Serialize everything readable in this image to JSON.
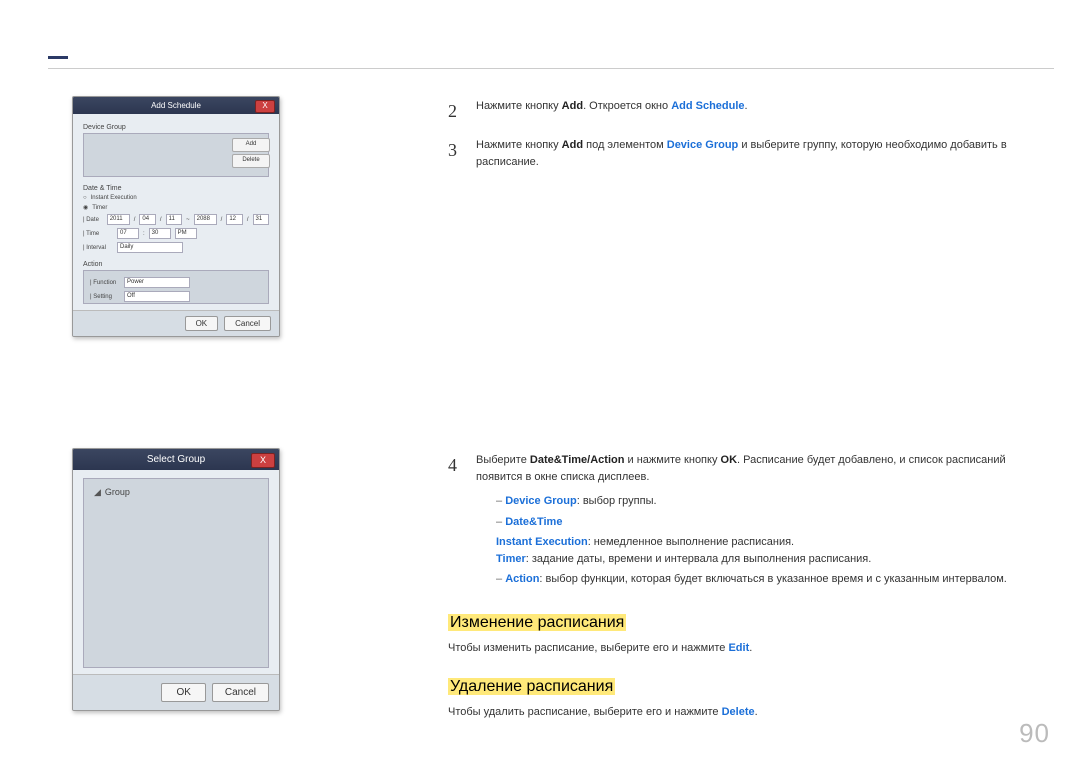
{
  "page_number": "90",
  "screenshot1": {
    "title": "Add Schedule",
    "close": "X",
    "section_devicegroup": "Device Group",
    "btn_add": "Add",
    "btn_delete": "Delete",
    "section_datetime": "Date & Time",
    "radio_instant": "Instant Execution",
    "radio_timer": "Timer",
    "row_date_label": "| Date",
    "date_y1": "2011",
    "date_m1": "04",
    "date_d1": "11",
    "date_tilde": "~",
    "date_y2": "2088",
    "date_m2": "12",
    "date_d2": "31",
    "row_time_label": "| Time",
    "time_h": "07",
    "time_m": "30",
    "time_ampm": "PM",
    "row_interval_label": "| Interval",
    "interval_val": "Daily",
    "section_action": "Action",
    "row_function_label": "| Function",
    "function_val": "Power",
    "row_setting_label": "| Setting",
    "setting_val": "Off",
    "btn_ok": "OK",
    "btn_cancel": "Cancel"
  },
  "screenshot2": {
    "title": "Select Group",
    "close": "X",
    "tree_root": "Group",
    "btn_ok": "OK",
    "btn_cancel": "Cancel"
  },
  "steps": {
    "s2_num": "2",
    "s2_a": "Нажмите кнопку ",
    "s2_b": "Add",
    "s2_c": ". Откроется окно ",
    "s2_d": "Add Schedule",
    "s2_e": ".",
    "s3_num": "3",
    "s3_a": "Нажмите кнопку ",
    "s3_b": "Add",
    "s3_c": " под элементом ",
    "s3_d": "Device Group",
    "s3_e": " и выберите группу, которую необходимо добавить в расписание.",
    "s4_num": "4",
    "s4_a": "Выберите ",
    "s4_b": "Date&Time",
    "s4_slash": "/",
    "s4_c": "Action",
    "s4_d": " и нажмите кнопку ",
    "s4_e": "OK",
    "s4_f": ". Расписание будет добавлено, и список расписаний появится в окне списка дисплеев.",
    "li1_a": "Device Group",
    "li1_b": ": выбор группы.",
    "li2": "Date&Time",
    "li2a_a": "Instant Execution",
    "li2a_b": ": немедленное выполнение расписания.",
    "li2b_a": "Timer",
    "li2b_b": ": задание даты, времени и интервала для выполнения расписания.",
    "li3_a": "Action",
    "li3_b": ": выбор функции, которая будет включаться в указанное время и с указанным интервалом."
  },
  "h_edit": "Изменение расписания",
  "p_edit_a": "Чтобы изменить расписание, выберите его и нажмите ",
  "p_edit_b": "Edit",
  "p_edit_c": ".",
  "h_del": "Удаление расписания",
  "p_del_a": "Чтобы удалить расписание, выберите его и нажмите ",
  "p_del_b": "Delete",
  "p_del_c": "."
}
